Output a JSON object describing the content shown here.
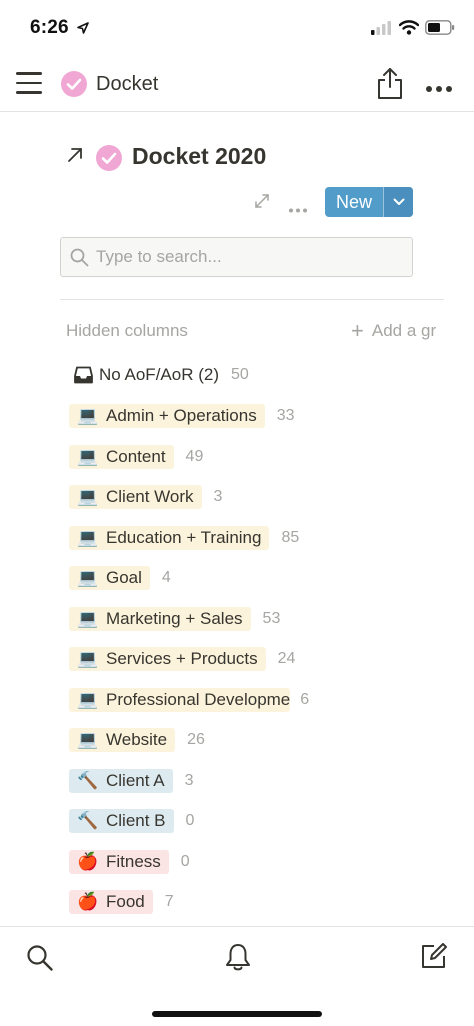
{
  "status_bar": {
    "time": "6:26"
  },
  "nav": {
    "title": "Docket"
  },
  "page": {
    "title": "Docket 2020",
    "new_label": "New",
    "search_placeholder": "Type to search...",
    "hidden_columns_label": "Hidden columns",
    "add_group_label": "Add a gr"
  },
  "groups": [
    {
      "label": "No AoF/AoR (2)",
      "count": "50",
      "emoji": "",
      "color": ""
    },
    {
      "label": "Admin + Operations",
      "count": "33",
      "emoji": "💻",
      "color": "yellow"
    },
    {
      "label": "Content",
      "count": "49",
      "emoji": "💻",
      "color": "yellow"
    },
    {
      "label": "Client Work",
      "count": "3",
      "emoji": "💻",
      "color": "yellow"
    },
    {
      "label": "Education + Training",
      "count": "85",
      "emoji": "💻",
      "color": "yellow"
    },
    {
      "label": "Goal",
      "count": "4",
      "emoji": "💻",
      "color": "yellow"
    },
    {
      "label": "Marketing + Sales",
      "count": "53",
      "emoji": "💻",
      "color": "yellow"
    },
    {
      "label": "Services + Products",
      "count": "24",
      "emoji": "💻",
      "color": "yellow"
    },
    {
      "label": "Professional Developme",
      "count": "6",
      "emoji": "💻",
      "color": "yellow"
    },
    {
      "label": "Website",
      "count": "26",
      "emoji": "💻",
      "color": "yellow"
    },
    {
      "label": "Client A",
      "count": "3",
      "emoji": "🔨",
      "color": "blue"
    },
    {
      "label": "Client B",
      "count": "0",
      "emoji": "🔨",
      "color": "blue"
    },
    {
      "label": "Fitness",
      "count": "0",
      "emoji": "🍎",
      "color": "red"
    },
    {
      "label": "Food",
      "count": "7",
      "emoji": "🍎",
      "color": "red"
    }
  ],
  "colors": {
    "accent_blue": "#529cca",
    "check_pink": "#f1a7d4",
    "tag_yellow": "#fbf3db",
    "tag_blue": "#ddebf1",
    "tag_red": "#fbe4e4"
  }
}
